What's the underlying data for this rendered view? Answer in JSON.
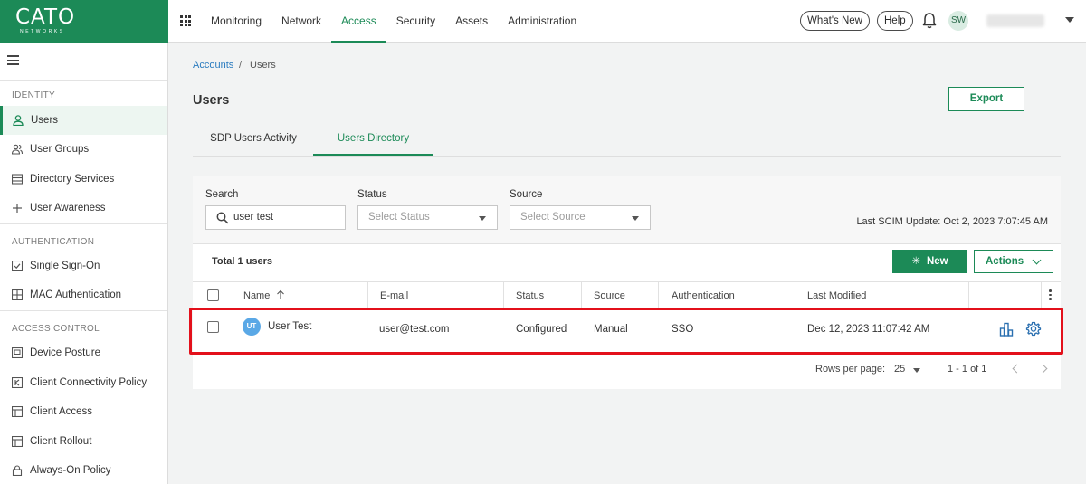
{
  "brand": {
    "name": "CATO",
    "subtitle": "NETWORKS",
    "color": "#1c8a57"
  },
  "topnav": {
    "apps_icon": "apps-grid-icon",
    "items": [
      "Monitoring",
      "Network",
      "Access",
      "Security",
      "Assets",
      "Administration"
    ],
    "active": "Access",
    "whats_new": "What's New",
    "help": "Help",
    "notifications_icon": "bell-icon",
    "user_initials": "SW",
    "account_dropdown_icon": "caret-down-icon"
  },
  "sidebar": {
    "menu_icon": "hamburger-icon",
    "sections": [
      {
        "title": "IDENTITY",
        "items": [
          {
            "label": "Users",
            "icon": "user-icon",
            "active": true
          },
          {
            "label": "User Groups",
            "icon": "user-group-icon"
          },
          {
            "label": "Directory Services",
            "icon": "directory-icon"
          },
          {
            "label": "User Awareness",
            "icon": "plus-icon"
          }
        ]
      },
      {
        "title": "AUTHENTICATION",
        "items": [
          {
            "label": "Single Sign-On",
            "icon": "checkbox-icon"
          },
          {
            "label": "MAC Authentication",
            "icon": "grid-icon"
          }
        ]
      },
      {
        "title": "ACCESS CONTROL",
        "items": [
          {
            "label": "Device Posture",
            "icon": "device-icon"
          },
          {
            "label": "Client Connectivity Policy",
            "icon": "policy-icon"
          },
          {
            "label": "Client Access",
            "icon": "table-icon"
          },
          {
            "label": "Client Rollout",
            "icon": "table-icon"
          },
          {
            "label": "Always-On Policy",
            "icon": "lock-icon"
          }
        ]
      }
    ]
  },
  "breadcrumb": {
    "parent": "Accounts",
    "separator": "/",
    "current": "Users"
  },
  "page": {
    "title": "Users",
    "export_label": "Export"
  },
  "tabs": [
    {
      "label": "SDP Users Activity",
      "active": false
    },
    {
      "label": "Users Directory",
      "active": true
    }
  ],
  "filters": {
    "search": {
      "label": "Search",
      "value": "user test",
      "icon": "search-icon"
    },
    "status": {
      "label": "Status",
      "placeholder": "Select Status"
    },
    "source": {
      "label": "Source",
      "placeholder": "Select Source"
    },
    "scim_update": "Last SCIM Update: Oct 2, 2023 7:07:45 AM"
  },
  "table": {
    "total": "Total 1 users",
    "new_label": "New",
    "new_icon": "sparkle-icon",
    "actions_label": "Actions",
    "columns": [
      "Name",
      "E-mail",
      "Status",
      "Source",
      "Authentication",
      "Last Modified"
    ],
    "sort_icon": "arrow-up-icon",
    "rows": [
      {
        "initials": "UT",
        "name": "User Test",
        "email": "user@test.com",
        "status": "Configured",
        "source": "Manual",
        "authentication": "SSO",
        "last_modified": "Dec 12, 2023 11:07:42 AM"
      }
    ],
    "row_icons": [
      "bar-chart-icon",
      "gear-icon"
    ],
    "highlight_color": "#e3101b"
  },
  "pagination": {
    "rows_per_page_label": "Rows per page:",
    "rows_per_page": "25",
    "range": "1 - 1 of 1"
  }
}
